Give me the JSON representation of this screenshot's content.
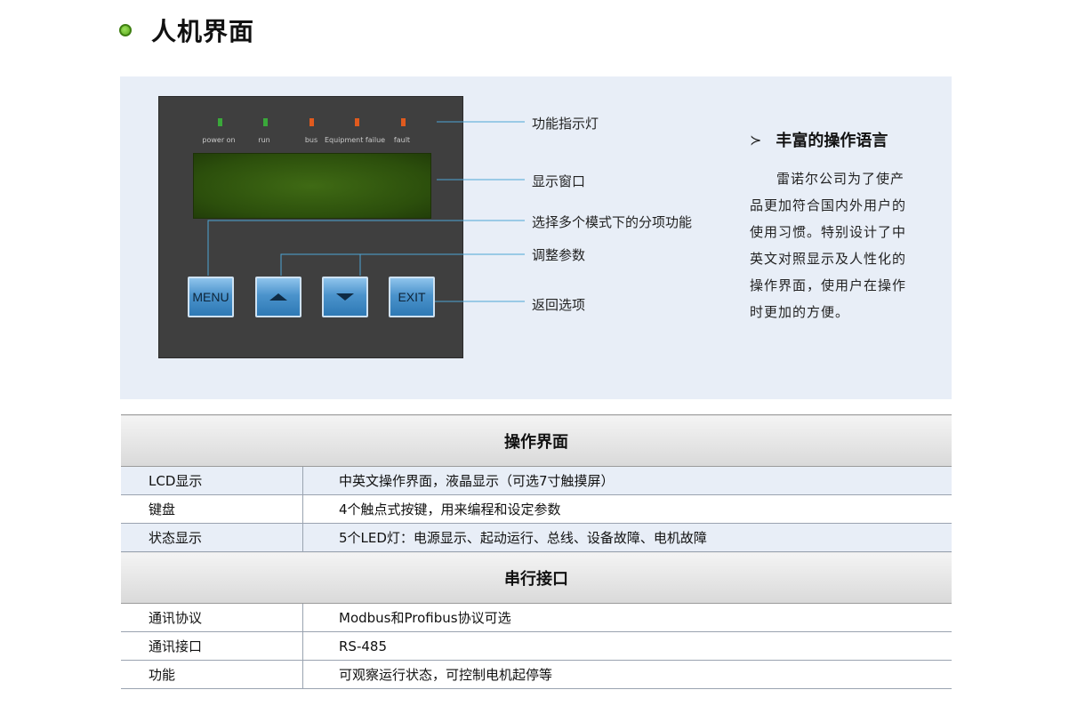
{
  "page": {
    "title": "人机界面"
  },
  "device": {
    "leds": [
      {
        "label": "power on",
        "color": "#3aa83a"
      },
      {
        "label": "run",
        "color": "#3aa83a"
      },
      {
        "label": "bus",
        "color": "#e05a1e"
      },
      {
        "label": "Equipment failue",
        "color": "#e05a1e"
      },
      {
        "label": "fault",
        "color": "#e05a1e"
      }
    ],
    "buttons": {
      "menu": "MENU",
      "exit": "EXIT"
    }
  },
  "callouts": {
    "indicator": "功能指示灯",
    "display": "显示窗口",
    "menu_select": "选择多个模式下的分项功能",
    "adjust": "调整参数",
    "back": "返回选项"
  },
  "feature": {
    "title": "丰富的操作语言",
    "body": "雷诺尔公司为了使产品更加符合国内外用户的使用习惯。特别设计了中英文对照显示及人性化的操作界面，使用户在操作时更加的方便。"
  },
  "table": {
    "sections": [
      {
        "title": "操作界面",
        "rows": [
          {
            "key": "LCD显示",
            "value": "中英文操作界面，液晶显示（可选7寸触摸屏）"
          },
          {
            "key": "键盘",
            "value": "4个触点式按键，用来编程和设定参数"
          },
          {
            "key": "状态显示",
            "value": "5个LED灯：电源显示、起动运行、总线、设备故障、电机故障"
          }
        ]
      },
      {
        "title": "串行接口",
        "rows": [
          {
            "key": "通讯协议",
            "value": "Modbus和Profibus协议可选"
          },
          {
            "key": "通讯接口",
            "value": "RS-485"
          },
          {
            "key": "功能",
            "value": "可观察运行状态，可控制电机起停等"
          }
        ]
      }
    ]
  }
}
